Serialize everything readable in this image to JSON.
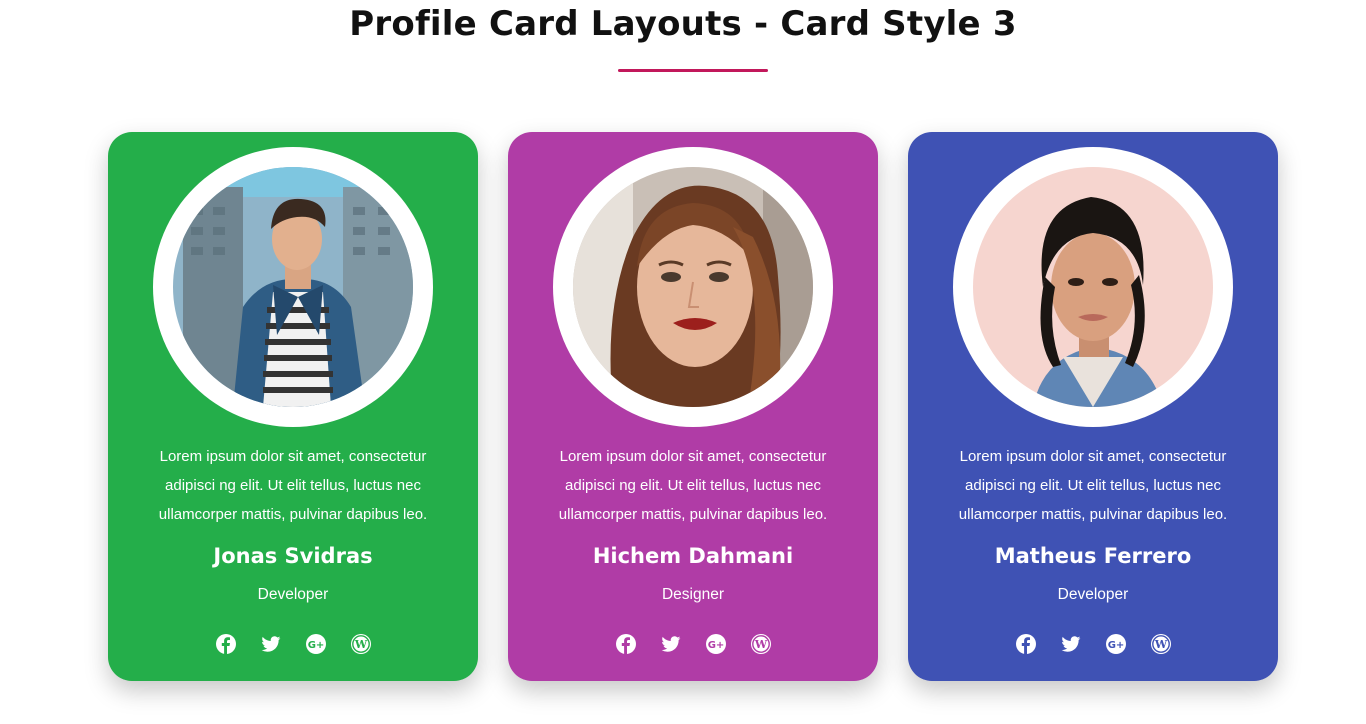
{
  "page": {
    "title": "Profile Card Layouts - Card Style 3",
    "accent_underline_color": "#c2185b"
  },
  "cards": [
    {
      "name": "Jonas Svidras",
      "role": "Developer",
      "bio": "Lorem ipsum dolor sit amet, consectetur adipisci ng elit. Ut elit tellus, luctus nec ullamcorper mattis, pulvinar dapibus leo.",
      "background_color": "#24ae4a",
      "photo": "man-in-denim-jacket-photo",
      "social_icons": [
        "facebook-icon",
        "twitter-icon",
        "google-plus-icon",
        "wordpress-icon"
      ]
    },
    {
      "name": "Hichem Dahmani",
      "role": "Designer",
      "bio": "Lorem ipsum dolor sit amet, consectetur adipisci ng elit. Ut elit tellus, luctus nec ullamcorper mattis, pulvinar dapibus leo.",
      "background_color": "#b03ca6",
      "photo": "woman-with-red-lips-photo",
      "social_icons": [
        "facebook-icon",
        "twitter-icon",
        "google-plus-icon",
        "wordpress-icon"
      ]
    },
    {
      "name": "Matheus Ferrero",
      "role": "Developer",
      "bio": "Lorem ipsum dolor sit amet, consectetur adipisci ng elit. Ut elit tellus, luctus nec ullamcorper mattis, pulvinar dapibus leo.",
      "background_color": "#3f52b4",
      "photo": "woman-in-denim-jacket-photo",
      "social_icons": [
        "facebook-icon",
        "twitter-icon",
        "google-plus-icon",
        "wordpress-icon"
      ]
    }
  ]
}
